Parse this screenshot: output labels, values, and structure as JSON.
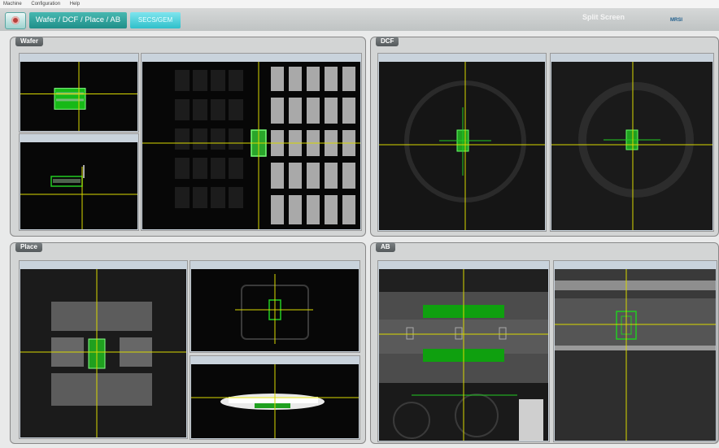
{
  "menu": [
    "Machine",
    "Configuration",
    "Help"
  ],
  "toolbar": {
    "tab_wafer_dcf_place_ab": "Wafer / DCF / Place / AB",
    "tab_selected": "SECS/GEM",
    "split_screen": "Split Screen",
    "logo": "MRSI"
  },
  "panels": {
    "wafer": {
      "title": "Wafer"
    },
    "dcf": {
      "title": "DCF"
    },
    "place": {
      "title": "Place"
    },
    "ab": {
      "title": "AB"
    }
  },
  "colors": {
    "crosshair": "#d8d800",
    "target": "#22cc22"
  }
}
